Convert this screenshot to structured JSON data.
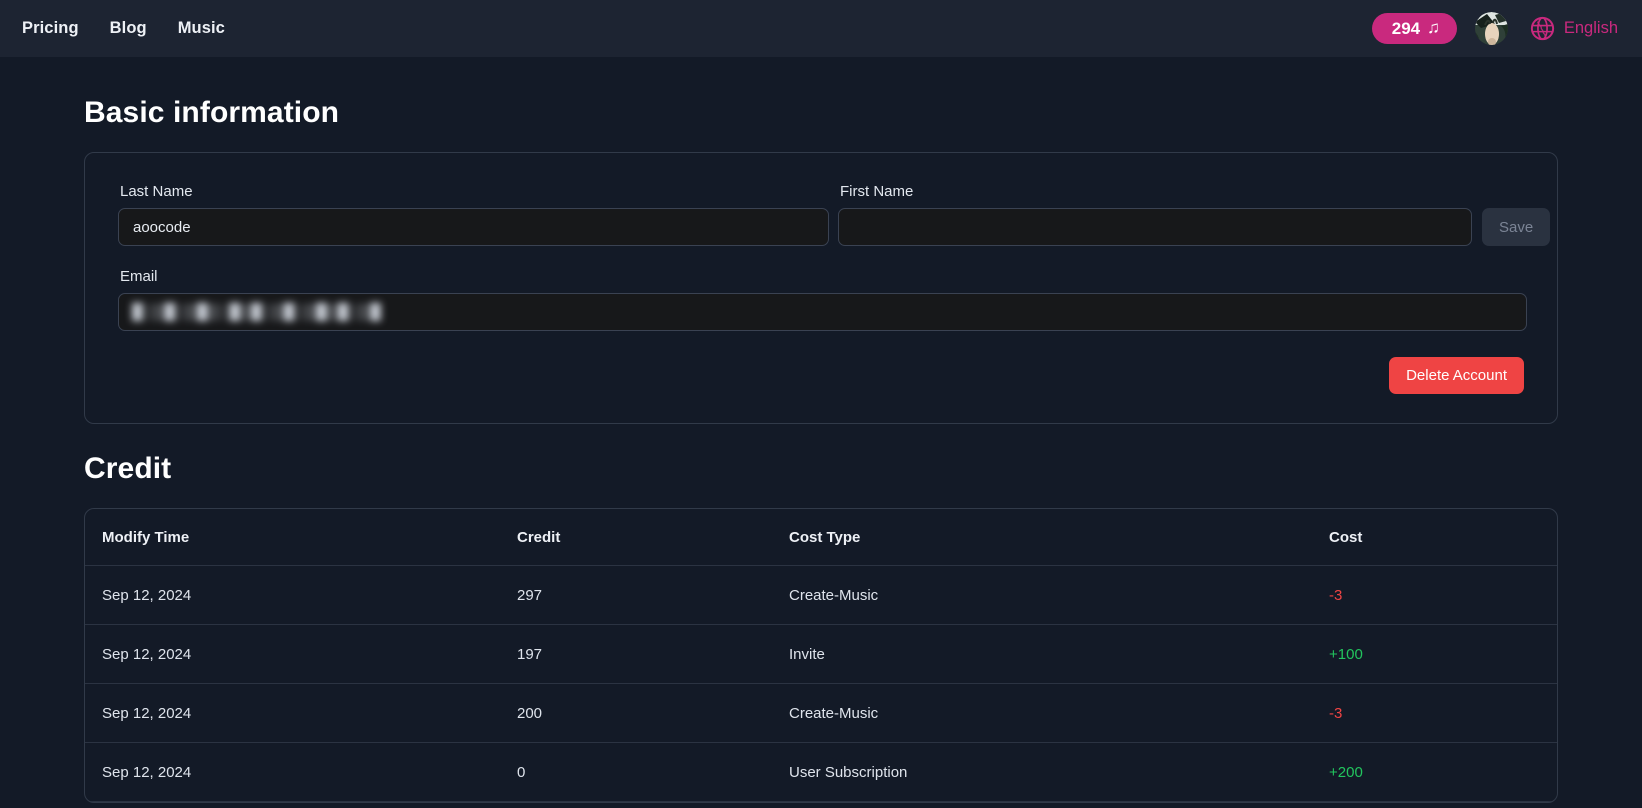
{
  "topbar": {
    "nav": [
      {
        "label": "Pricing"
      },
      {
        "label": "Blog"
      },
      {
        "label": "Music"
      }
    ],
    "credit_badge": {
      "value": "294",
      "icon": "music-note-icon",
      "color": "#c9297e"
    },
    "avatar": {
      "icon": "user-avatar-image"
    },
    "language": {
      "icon": "globe-icon",
      "label": "English",
      "color": "#c9297e"
    }
  },
  "basic_information": {
    "heading": "Basic information",
    "last_name": {
      "label": "Last Name",
      "value": "aoocode",
      "placeholder": ""
    },
    "first_name": {
      "label": "First Name",
      "value": "",
      "placeholder": ""
    },
    "email": {
      "label": "Email",
      "value": "█░▒█░▒█▒░█▒█░▒█░▒█▒█░▒█",
      "placeholder": ""
    },
    "save_label": "Save",
    "delete_label": "Delete Account",
    "delete_color": "#ef4444"
  },
  "credit": {
    "heading": "Credit",
    "columns": [
      "Modify Time",
      "Credit",
      "Cost Type",
      "Cost"
    ],
    "rows": [
      {
        "time": "Sep 12, 2024",
        "credit": "297",
        "type": "Create-Music",
        "cost": "-3",
        "sign": "neg"
      },
      {
        "time": "Sep 12, 2024",
        "credit": "197",
        "type": "Invite",
        "cost": "+100",
        "sign": "pos"
      },
      {
        "time": "Sep 12, 2024",
        "credit": "200",
        "type": "Create-Music",
        "cost": "-3",
        "sign": "neg"
      },
      {
        "time": "Sep 12, 2024",
        "credit": "0",
        "type": "User Subscription",
        "cost": "+200",
        "sign": "pos"
      }
    ],
    "cost_negative_color": "#ef4444",
    "cost_positive_color": "#22c55e"
  }
}
